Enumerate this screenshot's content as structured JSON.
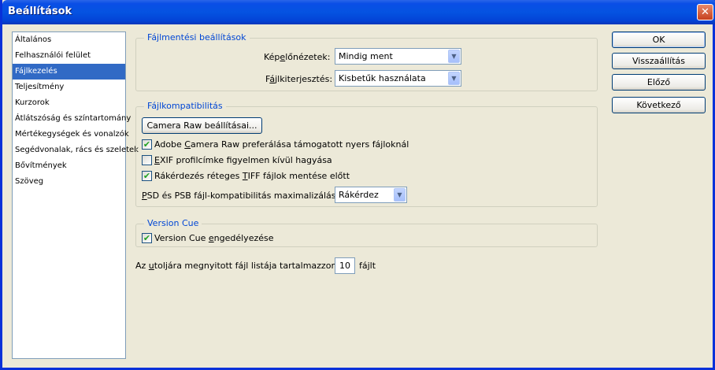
{
  "window": {
    "title": "Beállítások",
    "close_icon": "close-icon"
  },
  "sidebar": {
    "items": [
      {
        "label": "Általános",
        "selected": false
      },
      {
        "label": "Felhasználói felület",
        "selected": false
      },
      {
        "label": "Fájlkezelés",
        "selected": true
      },
      {
        "label": "Teljesítmény",
        "selected": false
      },
      {
        "label": "Kurzorok",
        "selected": false
      },
      {
        "label": "Átlátszóság és színtartomány",
        "selected": false
      },
      {
        "label": "Mértékegységek és vonalzók",
        "selected": false
      },
      {
        "label": "Segédvonalak, rács és szeletek",
        "selected": false
      },
      {
        "label": "Bővítmények",
        "selected": false
      },
      {
        "label": "Szöveg",
        "selected": false
      }
    ]
  },
  "file_saving": {
    "title": "Fájlmentési beállítások",
    "preview_label": "Képelőnézetek:",
    "preview_value": "Mindig ment",
    "extension_label": "Fájlkiterjesztés:",
    "extension_value": "Kisbetűk használata"
  },
  "compat": {
    "title": "Fájlkompatibilitás",
    "camera_raw_button": "Camera Raw beállításai...",
    "check1": {
      "label": "Adobe Camera Raw preferálása támogatott nyers fájloknál",
      "checked": true
    },
    "check2": {
      "label": "EXIF profilcímke figyelmen kívül hagyása",
      "checked": false
    },
    "check3": {
      "label": "Rákérdezés réteges TIFF fájlok mentése előtt",
      "checked": true
    },
    "psd_label": "PSD és PSB fájl-kompatibilitás maximalizálása:",
    "psd_value": "Rákérdez"
  },
  "version_cue": {
    "title": "Version Cue",
    "check": {
      "label": "Version Cue engedélyezése",
      "checked": true
    }
  },
  "recent": {
    "label_before": "Az utoljára megnyitott fájl listája tartalmazzon:",
    "value": "10",
    "label_after": "fájlt"
  },
  "buttons": {
    "ok": "OK",
    "reset": "Visszaállítás",
    "prev": "Előző",
    "next": "Következő"
  }
}
